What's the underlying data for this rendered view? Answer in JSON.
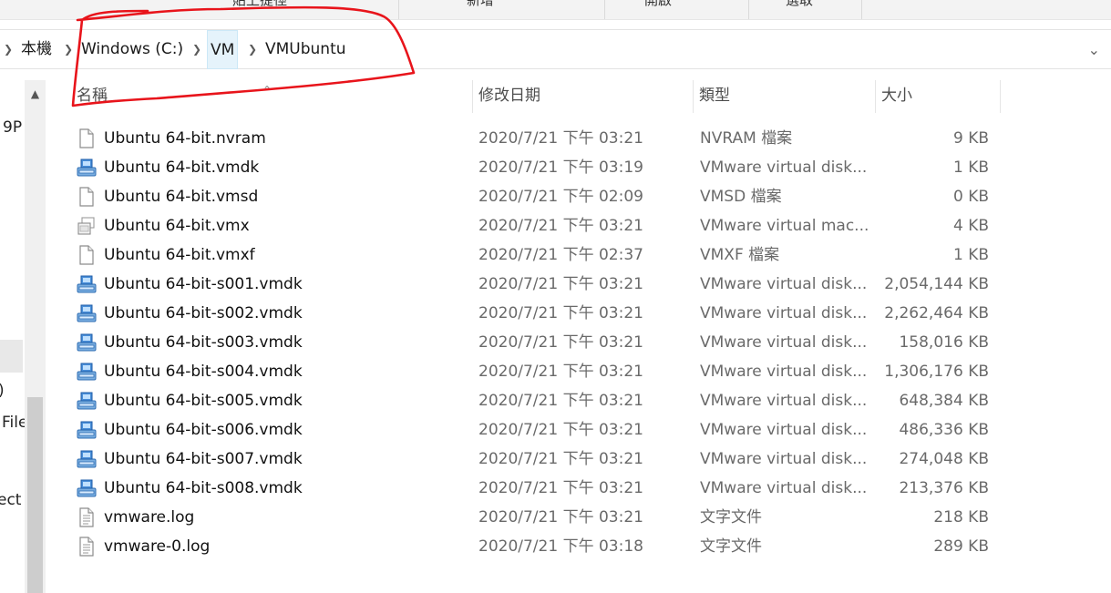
{
  "ribbon": {
    "items": [
      "貼上捷徑",
      "新增",
      "開啟",
      "選取"
    ]
  },
  "breadcrumb": {
    "root": "本機",
    "items": [
      "Windows (C:)",
      "VM",
      "VMUbuntu"
    ]
  },
  "nav_fragments": [
    "9P",
    ")",
    "File",
    "ect"
  ],
  "columns": {
    "name": "名稱",
    "date": "修改日期",
    "type": "類型",
    "size": "大小"
  },
  "files": [
    {
      "name": "Ubuntu 64-bit.nvram",
      "date": "2020/7/21 下午 03:21",
      "type": "NVRAM 檔案",
      "size": "9 KB",
      "icon": "blank-file-icon"
    },
    {
      "name": "Ubuntu 64-bit.vmdk",
      "date": "2020/7/21 下午 03:19",
      "type": "VMware virtual disk...",
      "size": "1 KB",
      "icon": "vmware-disk-icon"
    },
    {
      "name": "Ubuntu 64-bit.vmsd",
      "date": "2020/7/21 下午 02:09",
      "type": "VMSD 檔案",
      "size": "0 KB",
      "icon": "blank-file-icon"
    },
    {
      "name": "Ubuntu 64-bit.vmx",
      "date": "2020/7/21 下午 03:21",
      "type": "VMware virtual mac...",
      "size": "4 KB",
      "icon": "vmware-vm-icon"
    },
    {
      "name": "Ubuntu 64-bit.vmxf",
      "date": "2020/7/21 下午 02:37",
      "type": "VMXF 檔案",
      "size": "1 KB",
      "icon": "blank-file-icon"
    },
    {
      "name": "Ubuntu 64-bit-s001.vmdk",
      "date": "2020/7/21 下午 03:21",
      "type": "VMware virtual disk...",
      "size": "2,054,144 KB",
      "icon": "vmware-disk-icon"
    },
    {
      "name": "Ubuntu 64-bit-s002.vmdk",
      "date": "2020/7/21 下午 03:21",
      "type": "VMware virtual disk...",
      "size": "2,262,464 KB",
      "icon": "vmware-disk-icon"
    },
    {
      "name": "Ubuntu 64-bit-s003.vmdk",
      "date": "2020/7/21 下午 03:21",
      "type": "VMware virtual disk...",
      "size": "158,016 KB",
      "icon": "vmware-disk-icon"
    },
    {
      "name": "Ubuntu 64-bit-s004.vmdk",
      "date": "2020/7/21 下午 03:21",
      "type": "VMware virtual disk...",
      "size": "1,306,176 KB",
      "icon": "vmware-disk-icon"
    },
    {
      "name": "Ubuntu 64-bit-s005.vmdk",
      "date": "2020/7/21 下午 03:21",
      "type": "VMware virtual disk...",
      "size": "648,384 KB",
      "icon": "vmware-disk-icon"
    },
    {
      "name": "Ubuntu 64-bit-s006.vmdk",
      "date": "2020/7/21 下午 03:21",
      "type": "VMware virtual disk...",
      "size": "486,336 KB",
      "icon": "vmware-disk-icon"
    },
    {
      "name": "Ubuntu 64-bit-s007.vmdk",
      "date": "2020/7/21 下午 03:21",
      "type": "VMware virtual disk...",
      "size": "274,048 KB",
      "icon": "vmware-disk-icon"
    },
    {
      "name": "Ubuntu 64-bit-s008.vmdk",
      "date": "2020/7/21 下午 03:21",
      "type": "VMware virtual disk...",
      "size": "213,376 KB",
      "icon": "vmware-disk-icon"
    },
    {
      "name": "vmware.log",
      "date": "2020/7/21 下午 03:21",
      "type": "文字文件",
      "size": "218 KB",
      "icon": "text-file-icon"
    },
    {
      "name": "vmware-0.log",
      "date": "2020/7/21 下午 03:18",
      "type": "文字文件",
      "size": "289 KB",
      "icon": "text-file-icon"
    }
  ],
  "colors": {
    "annotation": "#e8141b",
    "selected_crumb": "#e5f3fb",
    "text_secondary": "#6a6a6a"
  }
}
